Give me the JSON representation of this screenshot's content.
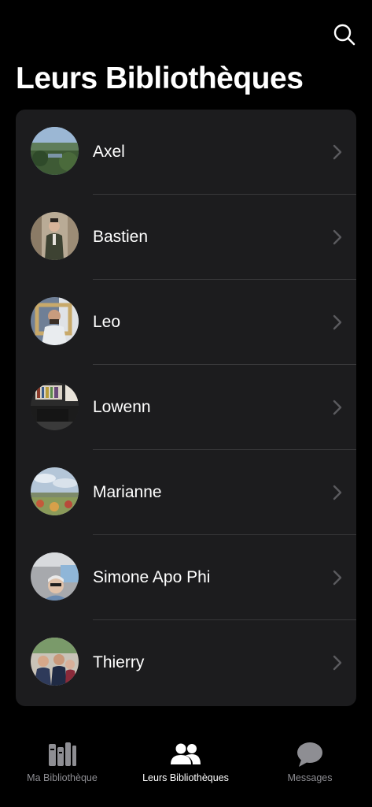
{
  "header": {
    "title": "Leurs Bibliothèques",
    "search_icon": "search-icon"
  },
  "friends": [
    {
      "name": "Axel",
      "avatar": "photo-landscape-river"
    },
    {
      "name": "Bastien",
      "avatar": "photo-man-in-suit"
    },
    {
      "name": "Leo",
      "avatar": "photo-man-with-frame"
    },
    {
      "name": "Lowenn",
      "avatar": "photo-room-bookshelf"
    },
    {
      "name": "Marianne",
      "avatar": "photo-sky-field"
    },
    {
      "name": "Simone Apo Phi",
      "avatar": "photo-car-selfie"
    },
    {
      "name": "Thierry",
      "avatar": "photo-people-garden"
    }
  ],
  "tabs": [
    {
      "label": "Ma Bibliothèque",
      "icon": "books-icon",
      "active": false
    },
    {
      "label": "Leurs Bibliothèques",
      "icon": "people-icon",
      "active": true
    },
    {
      "label": "Messages",
      "icon": "chat-bubble-icon",
      "active": false
    }
  ],
  "colors": {
    "background": "#000000",
    "card": "#1c1c1e",
    "separator": "#38383a",
    "chevron": "#5a5a5e",
    "tab_active": "#ffffff",
    "tab_inactive": "#8e8e93"
  }
}
